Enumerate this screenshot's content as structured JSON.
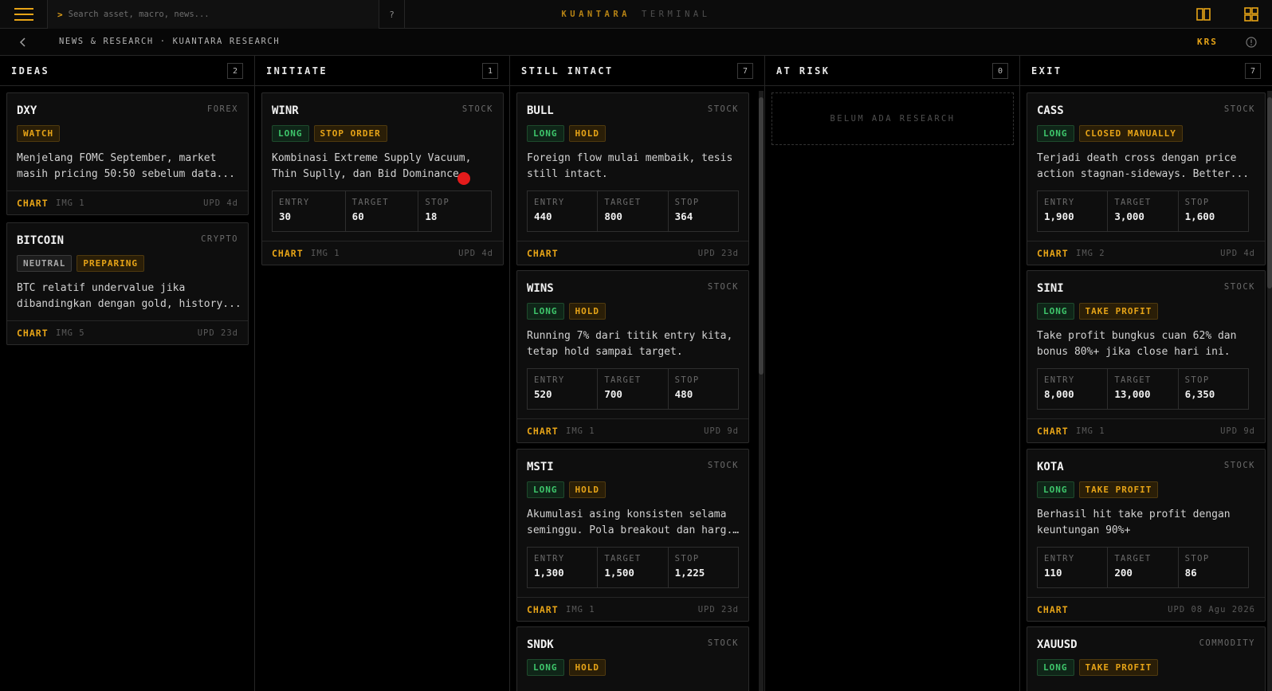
{
  "app": {
    "brand_primary": "KUANTARA",
    "brand_secondary": "TERMINAL",
    "search_placeholder": "Search asset, macro, news...",
    "search_prompt": ">",
    "help_label": "?",
    "accent_color": "#e7a417"
  },
  "subbar": {
    "breadcrumb": "NEWS & RESEARCH · KUANTARA RESEARCH",
    "user_code": "KRS"
  },
  "labels": {
    "entry": "ENTRY",
    "target": "TARGET",
    "stop": "STOP",
    "chart": "CHART"
  },
  "columns": [
    {
      "title": "IDEAS",
      "count": "2",
      "cards": [
        {
          "symbol": "DXY",
          "type": "FOREX",
          "tags": [
            {
              "text": "WATCH",
              "style": "amber"
            }
          ],
          "desc1": "Menjelang FOMC September, market",
          "desc2": "masih pricing 50:50 sebelum data...",
          "img": "IMG 1",
          "upd": "UPD 4d"
        },
        {
          "symbol": "BITCOIN",
          "type": "CRYPTO",
          "tags": [
            {
              "text": "NEUTRAL",
              "style": "neutral"
            },
            {
              "text": "PREPARING",
              "style": "amber"
            }
          ],
          "desc1": "BTC relatif undervalue jika",
          "desc2": "dibandingkan dengan gold, history...",
          "img": "IMG 5",
          "upd": "UPD 23d"
        }
      ]
    },
    {
      "title": "INITIATE",
      "count": "1",
      "cards": [
        {
          "symbol": "WINR",
          "type": "STOCK",
          "tags": [
            {
              "text": "LONG",
              "style": "long"
            },
            {
              "text": "STOP ORDER",
              "style": "amber"
            }
          ],
          "desc1": "Kombinasi Extreme Supply Vacuum,",
          "desc2": "Thin Suplly, dan Bid Dominance",
          "entry": "30",
          "target": "60",
          "stop": "18",
          "img": "IMG 1",
          "upd": "UPD 4d"
        }
      ]
    },
    {
      "title": "STILL INTACT",
      "count": "7",
      "cards": [
        {
          "symbol": "BULL",
          "type": "STOCK",
          "tags": [
            {
              "text": "LONG",
              "style": "long"
            },
            {
              "text": "HOLD",
              "style": "amber"
            }
          ],
          "desc1": "Foreign flow mulai membaik, tesis",
          "desc2": "still intact.",
          "entry": "440",
          "target": "800",
          "stop": "364",
          "img": "",
          "upd": "UPD 23d"
        },
        {
          "symbol": "WINS",
          "type": "STOCK",
          "tags": [
            {
              "text": "LONG",
              "style": "long"
            },
            {
              "text": "HOLD",
              "style": "amber"
            }
          ],
          "desc1": "Running 7% dari titik entry kita,",
          "desc2": "tetap hold sampai target.",
          "entry": "520",
          "target": "700",
          "stop": "480",
          "img": "IMG 1",
          "upd": "UPD 9d"
        },
        {
          "symbol": "MSTI",
          "type": "STOCK",
          "tags": [
            {
              "text": "LONG",
              "style": "long"
            },
            {
              "text": "HOLD",
              "style": "amber"
            }
          ],
          "desc1": "Akumulasi asing konsisten selama",
          "desc2": "seminggu. Pola breakout dan harg...",
          "entry": "1,300",
          "target": "1,500",
          "stop": "1,225",
          "img": "IMG 1",
          "upd": "UPD 23d"
        },
        {
          "symbol": "SNDK",
          "type": "STOCK",
          "tags": [
            {
              "text": "LONG",
              "style": "long"
            },
            {
              "text": "HOLD",
              "style": "amber"
            }
          ]
        }
      ]
    },
    {
      "title": "AT RISK",
      "count": "0",
      "empty_text": "BELUM ADA RESEARCH",
      "cards": []
    },
    {
      "title": "EXIT",
      "count": "7",
      "cards": [
        {
          "symbol": "CASS",
          "type": "STOCK",
          "tags": [
            {
              "text": "LONG",
              "style": "long"
            },
            {
              "text": "CLOSED MANUALLY",
              "style": "amber"
            }
          ],
          "desc1": "Terjadi death cross dengan price",
          "desc2": "action stagnan-sideways. Better...",
          "entry": "1,900",
          "target": "3,000",
          "stop": "1,600",
          "img": "IMG 2",
          "upd": "UPD 4d"
        },
        {
          "symbol": "SINI",
          "type": "STOCK",
          "tags": [
            {
              "text": "LONG",
              "style": "long"
            },
            {
              "text": "TAKE PROFIT",
              "style": "amber"
            }
          ],
          "desc1": "Take profit bungkus cuan 62% dan",
          "desc2": "bonus 80%+ jika close hari ini.",
          "entry": "8,000",
          "target": "13,000",
          "stop": "6,350",
          "img": "IMG 1",
          "upd": "UPD 9d"
        },
        {
          "symbol": "KOTA",
          "type": "STOCK",
          "tags": [
            {
              "text": "LONG",
              "style": "long"
            },
            {
              "text": "TAKE PROFIT",
              "style": "amber"
            }
          ],
          "desc1": "Berhasil hit take profit dengan",
          "desc2": "keuntungan 90%+",
          "entry": "110",
          "target": "200",
          "stop": "86",
          "img": "",
          "upd": "UPD 08 Agu 2026"
        },
        {
          "symbol": "XAUUSD",
          "type": "COMMODITY",
          "tags": [
            {
              "text": "LONG",
              "style": "long"
            },
            {
              "text": "TAKE PROFIT",
              "style": "amber"
            }
          ]
        }
      ]
    }
  ]
}
